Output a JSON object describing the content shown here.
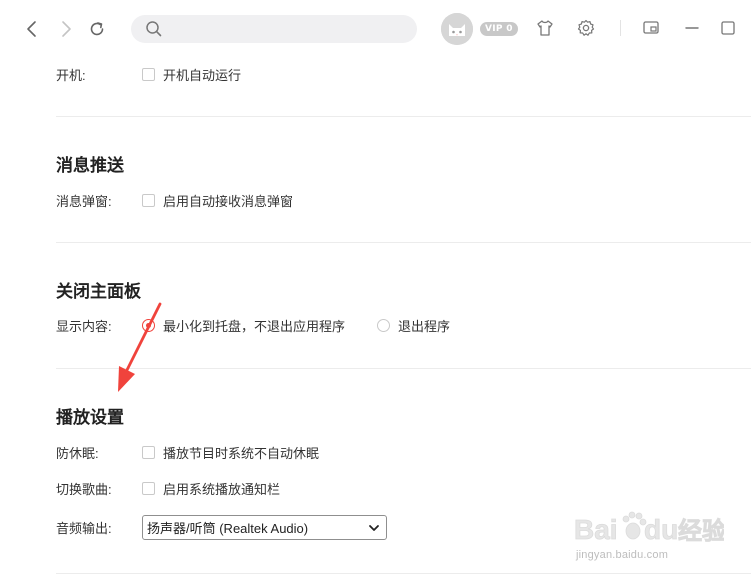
{
  "toolbar": {
    "search_placeholder": "",
    "vip_label": "VIP 0"
  },
  "sections": {
    "startup": {
      "label": "开机:",
      "checkbox_label": "开机自动运行"
    },
    "push": {
      "title": "消息推送",
      "label": "消息弹窗:",
      "checkbox_label": "启用自动接收消息弹窗"
    },
    "close_panel": {
      "title": "关闭主面板",
      "label": "显示内容:",
      "option_minimize": "最小化到托盘，不退出应用程序",
      "option_exit": "退出程序",
      "selected": "minimize"
    },
    "playback": {
      "title": "播放设置",
      "anti_sleep_label": "防休眠:",
      "anti_sleep_checkbox": "播放节目时系统不自动休眠",
      "switch_song_label": "切换歌曲:",
      "switch_song_checkbox": "启用系统播放通知栏",
      "audio_output_label": "音频输出:",
      "audio_output_value": "扬声器/听筒 (Realtek Audio)"
    }
  },
  "watermark": {
    "brand": "Bai",
    "brand2": "du",
    "suffix": "经验",
    "url": "jingyan.baidu.com"
  },
  "colors": {
    "accent": "#f0433c",
    "arrow": "#f0433c",
    "divider": "#ececec"
  }
}
